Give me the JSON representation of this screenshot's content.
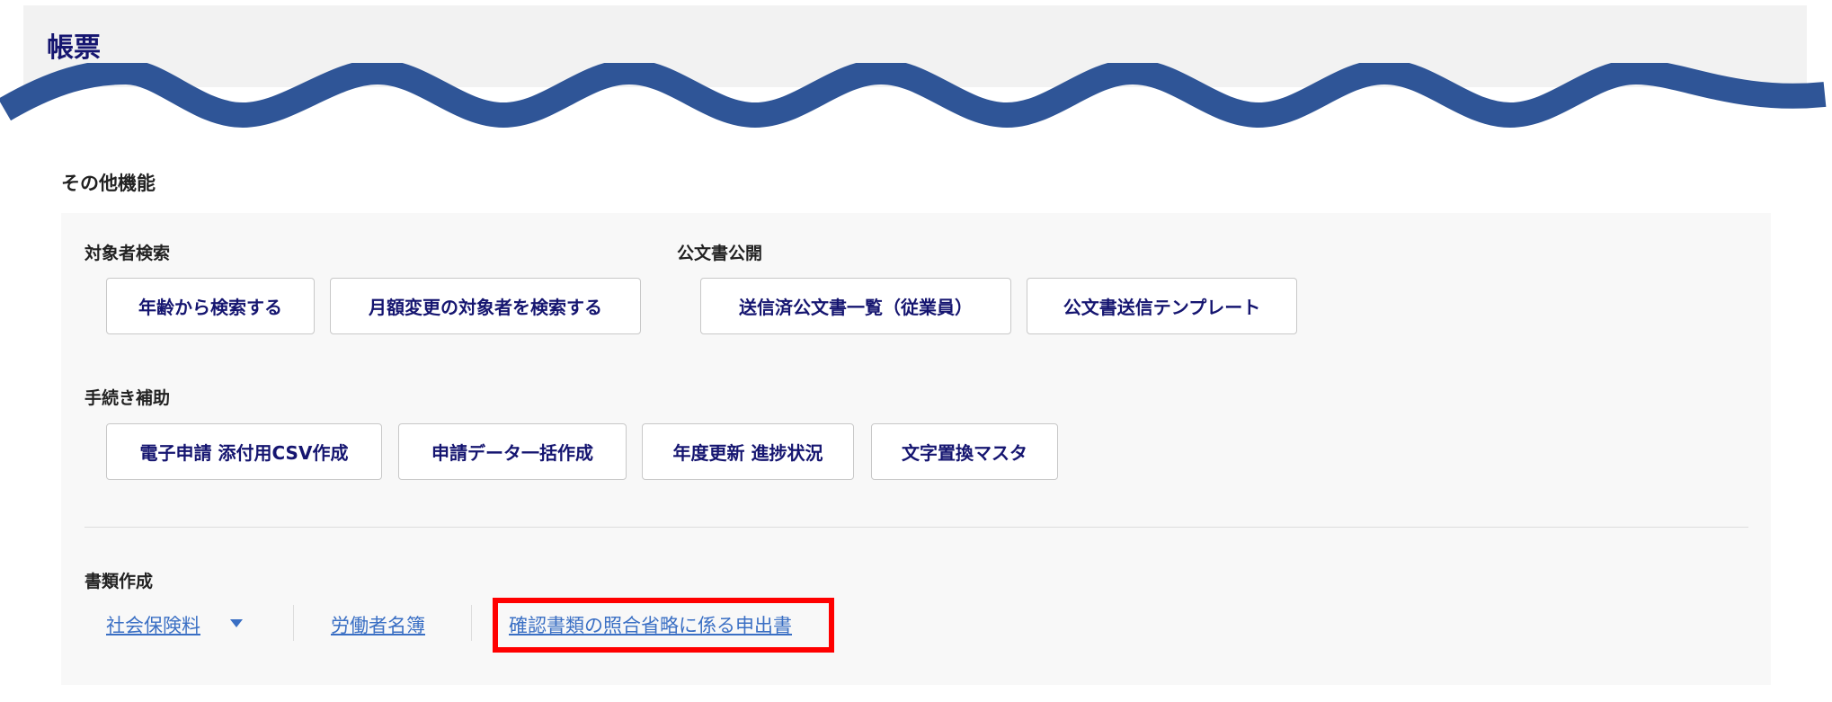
{
  "header": {
    "title": "帳票"
  },
  "section_title": "その他機能",
  "groups": {
    "search": {
      "label": "対象者検索",
      "buttons": [
        "年齢から検索する",
        "月額変更の対象者を検索する"
      ]
    },
    "public_docs": {
      "label": "公文書公開",
      "buttons": [
        "送信済公文書一覧（従業員）",
        "公文書送信テンプレート"
      ]
    },
    "procedure": {
      "label": "手続き補助",
      "buttons": [
        "電子申請 添付用CSV作成",
        "申請データ一括作成",
        "年度更新 進捗状況",
        "文字置換マスタ"
      ]
    },
    "documents": {
      "label": "書類作成",
      "links": [
        "社会保険料",
        "労働者名簿",
        "確認書類の照合省略に係る申出書"
      ]
    }
  },
  "colors": {
    "wave": "#2f5597",
    "title": "#151570",
    "link": "#3a6fc4",
    "highlight": "#ff0000"
  }
}
